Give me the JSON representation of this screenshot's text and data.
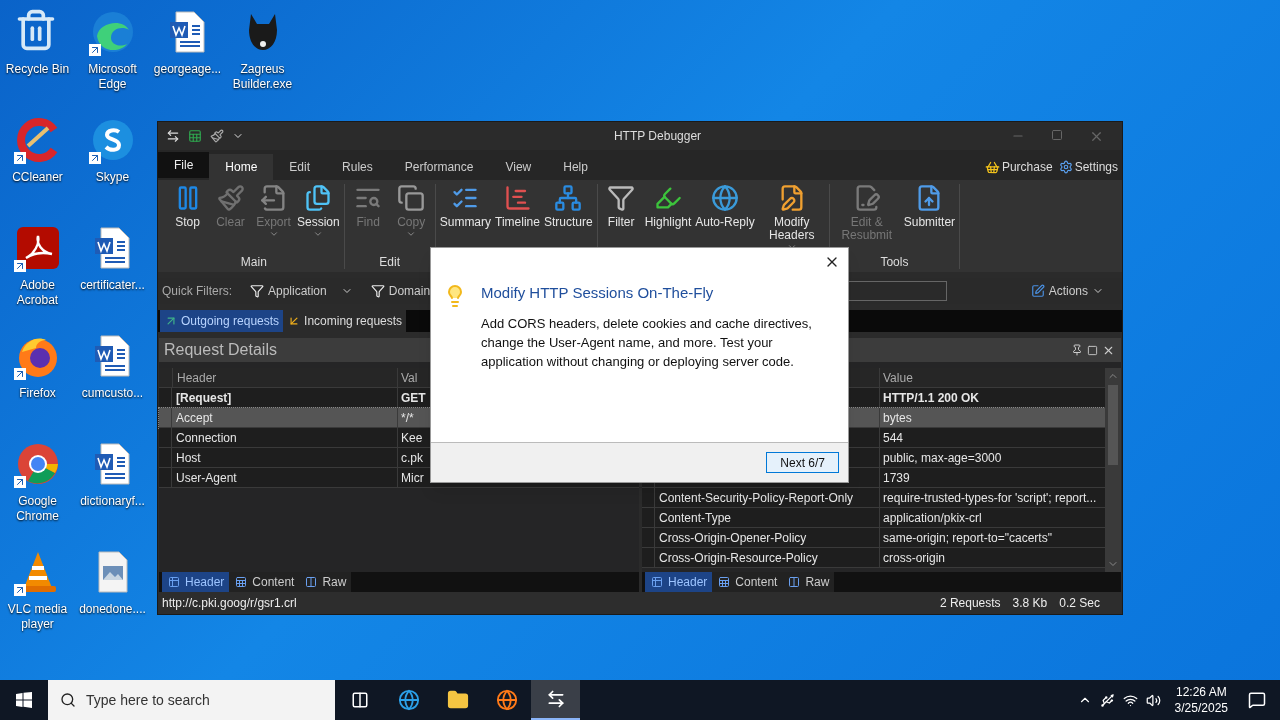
{
  "desktop_rows": [
    [
      {
        "label": "Recycle Bin",
        "shortcut": false
      },
      {
        "label": "Microsoft Edge",
        "shortcut": true
      },
      {
        "label": "georgeage...",
        "shortcut": false
      },
      {
        "label": "Zagreus Builder.exe",
        "shortcut": false
      }
    ],
    [
      {
        "label": "CCleaner",
        "shortcut": true
      },
      {
        "label": "Skype",
        "shortcut": true
      }
    ],
    [
      {
        "label": "Adobe Acrobat",
        "shortcut": true
      },
      {
        "label": "certificater...",
        "shortcut": false
      }
    ],
    [
      {
        "label": "Firefox",
        "shortcut": true
      },
      {
        "label": "cumcusto...",
        "shortcut": false
      }
    ],
    [
      {
        "label": "Google Chrome",
        "shortcut": true
      },
      {
        "label": "dictionaryf...",
        "shortcut": false
      }
    ],
    [
      {
        "label": "VLC media player",
        "shortcut": true
      },
      {
        "label": "donedone....",
        "shortcut": false
      }
    ]
  ],
  "window": {
    "title": "HTTP Debugger",
    "menu_tabs": [
      {
        "label": "File",
        "kind": "backstage",
        "selected": false
      },
      {
        "label": "Home",
        "kind": "tab",
        "selected": true
      },
      {
        "label": "Edit",
        "kind": "tab",
        "selected": false
      },
      {
        "label": "Rules",
        "kind": "tab",
        "selected": false
      },
      {
        "label": "Performance",
        "kind": "tab",
        "selected": false
      },
      {
        "label": "View",
        "kind": "tab",
        "selected": false
      },
      {
        "label": "Help",
        "kind": "tab",
        "selected": false
      }
    ],
    "purchase": "Purchase",
    "settings": "Settings",
    "ribbon_groups": [
      {
        "label": "Main",
        "buttons": [
          {
            "label": "Stop",
            "disabled": false,
            "dropdown": false
          },
          {
            "label": "Clear",
            "disabled": true,
            "dropdown": false
          },
          {
            "label": "Export",
            "disabled": true,
            "dropdown": true
          },
          {
            "label": "Session",
            "disabled": false,
            "dropdown": true
          }
        ]
      },
      {
        "label": "Edit",
        "buttons": [
          {
            "label": "Find",
            "disabled": true,
            "dropdown": false
          },
          {
            "label": "Copy",
            "disabled": true,
            "dropdown": true
          }
        ]
      },
      {
        "buttons": [
          {
            "label": "Summary",
            "disabled": false,
            "dropdown": false
          },
          {
            "label": "Timeline",
            "disabled": false,
            "dropdown": false
          },
          {
            "label": "Structure",
            "disabled": false,
            "dropdown": false
          }
        ]
      },
      {
        "buttons": [
          {
            "label": "Filter",
            "disabled": false,
            "dropdown": false
          },
          {
            "label": "Highlight",
            "disabled": false,
            "dropdown": false
          },
          {
            "label": "Auto-Reply",
            "disabled": false,
            "dropdown": false
          },
          {
            "label": "Modify Headers",
            "disabled": false,
            "dropdown": true
          }
        ]
      },
      {
        "label": "Tools",
        "buttons": [
          {
            "label": "Edit & Resubmit",
            "disabled": true,
            "dropdown": false
          },
          {
            "label": "Submitter",
            "disabled": false,
            "dropdown": false
          }
        ]
      }
    ],
    "quick_filters": {
      "label": "Quick Filters:",
      "filters": [
        "Application",
        "Domain"
      ],
      "actions": "Actions"
    },
    "request_tabs": [
      {
        "label": "Outgoing requests",
        "selected": true
      },
      {
        "label": "Incoming requests",
        "selected": false
      }
    ],
    "request_panel": {
      "title": "Request Details",
      "columns": [
        "Header",
        "Val"
      ],
      "rows": [
        {
          "kind": "status",
          "header": "[Request]",
          "value": "GET",
          "selected": false
        },
        {
          "kind": "field",
          "header": "Accept",
          "value": "*/*",
          "selected": true
        },
        {
          "kind": "field",
          "header": "Connection",
          "value": "Kee",
          "selected": false
        },
        {
          "kind": "field",
          "header": "Host",
          "value": "c.pk",
          "selected": false
        },
        {
          "kind": "field",
          "header": "User-Agent",
          "value": "Micr",
          "selected": false
        }
      ],
      "tabs": [
        {
          "label": "Header",
          "selected": true
        },
        {
          "label": "Content",
          "selected": false
        },
        {
          "label": "Raw",
          "selected": false
        }
      ]
    },
    "response_panel": {
      "columns": [
        "Value"
      ],
      "rows": [
        {
          "kind": "status",
          "value": "HTTP/1.1 200 OK",
          "selected": false
        },
        {
          "kind": "field",
          "value": "bytes",
          "selected": true
        },
        {
          "kind": "field",
          "value": "544",
          "selected": false
        },
        {
          "kind": "field",
          "value": "public, max-age=3000",
          "selected": false
        },
        {
          "kind": "field",
          "value": "1739",
          "selected": false
        },
        {
          "kind": "field",
          "header": "Content-Security-Policy-Report-Only",
          "value": "require-trusted-types-for 'script'; report...",
          "selected": false
        },
        {
          "kind": "field",
          "header": "Content-Type",
          "value": "application/pkix-crl",
          "selected": false
        },
        {
          "kind": "field",
          "header": "Cross-Origin-Opener-Policy",
          "value": "same-origin; report-to=\"cacerts\"",
          "selected": false
        },
        {
          "kind": "field",
          "header": "Cross-Origin-Resource-Policy",
          "value": "cross-origin",
          "selected": false
        }
      ],
      "tabs": [
        {
          "label": "Header",
          "selected": true
        },
        {
          "label": "Content",
          "selected": false
        },
        {
          "label": "Raw",
          "selected": false
        }
      ]
    },
    "status_bar": {
      "url": "http://c.pki.goog/r/gsr1.crl",
      "requests": "2 Requests",
      "size": "3.8 Kb",
      "time": "0.2 Sec"
    }
  },
  "dialog": {
    "title": "Modify HTTP Sessions On-The-Fly",
    "body": "Add CORS headers, delete cookies and cache directives, change the User-Agent name, and more. Test your application without changing or deploying server code.",
    "button": "Next 6/7"
  },
  "taskbar": {
    "search_placeholder": "Type here to search",
    "apps": [
      {
        "selected": false
      },
      {
        "selected": false
      },
      {
        "selected": false
      },
      {
        "selected": false
      },
      {
        "selected": true
      }
    ],
    "time": "12:26 AM",
    "date": "3/25/2025"
  }
}
